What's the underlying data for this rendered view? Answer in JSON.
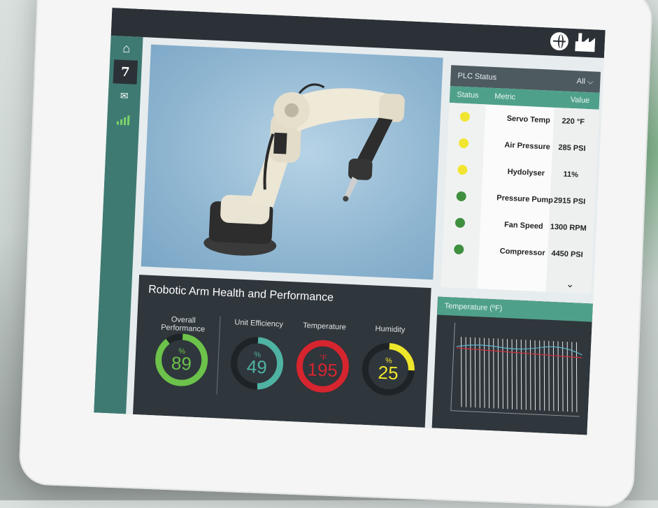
{
  "topbar": {
    "icons": [
      "globe-icon",
      "factory-icon"
    ]
  },
  "sidebar": {
    "items": [
      {
        "icon": "home-icon",
        "glyph": "⌂"
      },
      {
        "icon": "robot-arm-icon",
        "glyph": "7"
      },
      {
        "icon": "mail-icon",
        "glyph": "✉"
      },
      {
        "icon": "signal-bars-icon",
        "glyph": ""
      }
    ]
  },
  "plc": {
    "title": "PLC Status",
    "filter": "All",
    "columns": [
      "Status",
      "Metric",
      "Value"
    ],
    "rows": [
      {
        "metric": "Servo Temp",
        "value": "220 °F",
        "status_color": "#f2e531"
      },
      {
        "metric": "Air Pressure",
        "value": "285 PSI",
        "status_color": "#f2e531"
      },
      {
        "metric": "Hydolyser",
        "value": "11%",
        "status_color": "#f2e531"
      },
      {
        "metric": "Pressure Pump",
        "value": "2915 PSI",
        "status_color": "#3e8f3e"
      },
      {
        "metric": "Fan Speed",
        "value": "1300 RPM",
        "status_color": "#3e8f3e"
      },
      {
        "metric": "Compressor",
        "value": "4450 PSI",
        "status_color": "#3e8f3e"
      }
    ]
  },
  "health": {
    "title": "Robotic Arm Health and  Performance",
    "gauges": [
      {
        "label": "Overall Performance",
        "unit": "%",
        "value": "89",
        "color": "#6cc24a"
      },
      {
        "label": "Unit Efficiency",
        "unit": "%",
        "value": "49",
        "color": "#4fb3a3"
      },
      {
        "label": "Temperature",
        "unit": "°F",
        "value": "195",
        "color": "#d6252f"
      },
      {
        "label": "Humidity",
        "unit": "%",
        "value": "25",
        "color": "#eee62b"
      }
    ]
  },
  "temperature_panel": {
    "title": "Temperature (ºF)"
  }
}
